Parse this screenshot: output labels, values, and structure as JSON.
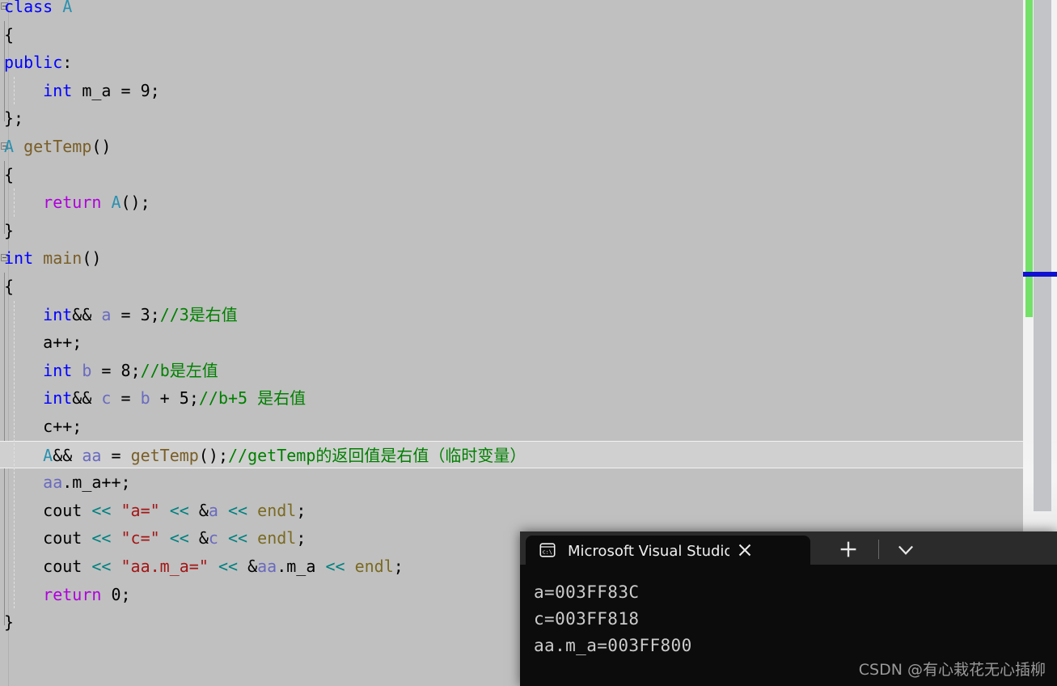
{
  "editor": {
    "background_color": "#c0c0c0",
    "current_line_index": 16,
    "lines": [
      {
        "indent": 0,
        "fold": "collapse",
        "tokens": [
          {
            "t": "class ",
            "c": "kw"
          },
          {
            "t": "A",
            "c": "typ"
          }
        ]
      },
      {
        "indent": 0,
        "fold": "bar",
        "tokens": [
          {
            "t": "{",
            "c": "pl"
          }
        ]
      },
      {
        "indent": 0,
        "fold": "bar",
        "tokens": [
          {
            "t": "public",
            "c": "kw"
          },
          {
            "t": ":",
            "c": "pl"
          }
        ]
      },
      {
        "indent": 0,
        "fold": "bar",
        "tokens": [
          {
            "t": "    ",
            "c": "pl"
          },
          {
            "t": "int",
            "c": "kw"
          },
          {
            "t": " m_a = ",
            "c": "pl"
          },
          {
            "t": "9",
            "c": "num"
          },
          {
            "t": ";",
            "c": "pl"
          }
        ]
      },
      {
        "indent": 0,
        "fold": "barend",
        "tokens": [
          {
            "t": "};",
            "c": "pl"
          }
        ]
      },
      {
        "indent": 0,
        "fold": "collapse",
        "tokens": [
          {
            "t": "A",
            "c": "typ"
          },
          {
            "t": " ",
            "c": "pl"
          },
          {
            "t": "getTemp",
            "c": "fn"
          },
          {
            "t": "()",
            "c": "pl"
          }
        ]
      },
      {
        "indent": 0,
        "fold": "bar",
        "tokens": [
          {
            "t": "{",
            "c": "pl"
          }
        ]
      },
      {
        "indent": 0,
        "fold": "bar",
        "tokens": [
          {
            "t": "    ",
            "c": "pl"
          },
          {
            "t": "return",
            "c": "ctl"
          },
          {
            "t": " ",
            "c": "pl"
          },
          {
            "t": "A",
            "c": "typ"
          },
          {
            "t": "();",
            "c": "pl"
          }
        ]
      },
      {
        "indent": 0,
        "fold": "barend",
        "tokens": [
          {
            "t": "}",
            "c": "pl"
          }
        ]
      },
      {
        "indent": 0,
        "fold": "collapse",
        "tokens": [
          {
            "t": "int",
            "c": "kw"
          },
          {
            "t": " ",
            "c": "pl"
          },
          {
            "t": "main",
            "c": "fn"
          },
          {
            "t": "()",
            "c": "pl"
          }
        ]
      },
      {
        "indent": 0,
        "fold": "bar",
        "tokens": [
          {
            "t": "{",
            "c": "pl"
          }
        ]
      },
      {
        "indent": 0,
        "fold": "bar",
        "tokens": [
          {
            "t": "    ",
            "c": "pl"
          },
          {
            "t": "int",
            "c": "kw"
          },
          {
            "t": "&& ",
            "c": "pl"
          },
          {
            "t": "a",
            "c": "var"
          },
          {
            "t": " = ",
            "c": "pl"
          },
          {
            "t": "3",
            "c": "num"
          },
          {
            "t": ";",
            "c": "pl"
          },
          {
            "t": "//3是右值",
            "c": "cmt"
          }
        ]
      },
      {
        "indent": 0,
        "fold": "bar",
        "tokens": [
          {
            "t": "    a++;",
            "c": "pl"
          }
        ]
      },
      {
        "indent": 0,
        "fold": "bar",
        "tokens": [
          {
            "t": "    ",
            "c": "pl"
          },
          {
            "t": "int",
            "c": "kw"
          },
          {
            "t": " ",
            "c": "pl"
          },
          {
            "t": "b",
            "c": "var"
          },
          {
            "t": " = ",
            "c": "pl"
          },
          {
            "t": "8",
            "c": "num"
          },
          {
            "t": ";",
            "c": "pl"
          },
          {
            "t": "//b是左值",
            "c": "cmt"
          }
        ]
      },
      {
        "indent": 0,
        "fold": "bar",
        "tokens": [
          {
            "t": "    ",
            "c": "pl"
          },
          {
            "t": "int",
            "c": "kw"
          },
          {
            "t": "&& ",
            "c": "pl"
          },
          {
            "t": "c",
            "c": "var"
          },
          {
            "t": " = ",
            "c": "pl"
          },
          {
            "t": "b",
            "c": "var"
          },
          {
            "t": " + ",
            "c": "pl"
          },
          {
            "t": "5",
            "c": "num"
          },
          {
            "t": ";",
            "c": "pl"
          },
          {
            "t": "//b+5 是右值",
            "c": "cmt"
          }
        ]
      },
      {
        "indent": 0,
        "fold": "bar",
        "tokens": [
          {
            "t": "    c++;",
            "c": "pl"
          }
        ]
      },
      {
        "indent": 0,
        "fold": "bar",
        "tokens": [
          {
            "t": "    ",
            "c": "pl"
          },
          {
            "t": "A",
            "c": "typ"
          },
          {
            "t": "&& ",
            "c": "pl"
          },
          {
            "t": "aa",
            "c": "var"
          },
          {
            "t": " = ",
            "c": "pl"
          },
          {
            "t": "getTemp",
            "c": "fn"
          },
          {
            "t": "();",
            "c": "pl"
          },
          {
            "t": "//getTemp的返回值是右值（临时变量）",
            "c": "cmt"
          }
        ]
      },
      {
        "indent": 0,
        "fold": "bar",
        "tokens": [
          {
            "t": "    ",
            "c": "pl"
          },
          {
            "t": "aa",
            "c": "var"
          },
          {
            "t": ".m_a++;",
            "c": "pl"
          }
        ]
      },
      {
        "indent": 0,
        "fold": "bar",
        "tokens": [
          {
            "t": "    cout ",
            "c": "pl"
          },
          {
            "t": "<<",
            "c": "op"
          },
          {
            "t": " ",
            "c": "pl"
          },
          {
            "t": "\"a=\"",
            "c": "str"
          },
          {
            "t": " ",
            "c": "pl"
          },
          {
            "t": "<<",
            "c": "op"
          },
          {
            "t": " &",
            "c": "pl"
          },
          {
            "t": "a",
            "c": "var"
          },
          {
            "t": " ",
            "c": "pl"
          },
          {
            "t": "<<",
            "c": "op"
          },
          {
            "t": " ",
            "c": "pl"
          },
          {
            "t": "endl",
            "c": "endl"
          },
          {
            "t": ";",
            "c": "pl"
          }
        ]
      },
      {
        "indent": 0,
        "fold": "bar",
        "tokens": [
          {
            "t": "    cout ",
            "c": "pl"
          },
          {
            "t": "<<",
            "c": "op"
          },
          {
            "t": " ",
            "c": "pl"
          },
          {
            "t": "\"c=\"",
            "c": "str"
          },
          {
            "t": " ",
            "c": "pl"
          },
          {
            "t": "<<",
            "c": "op"
          },
          {
            "t": " &",
            "c": "pl"
          },
          {
            "t": "c",
            "c": "var"
          },
          {
            "t": " ",
            "c": "pl"
          },
          {
            "t": "<<",
            "c": "op"
          },
          {
            "t": " ",
            "c": "pl"
          },
          {
            "t": "endl",
            "c": "endl"
          },
          {
            "t": ";",
            "c": "pl"
          }
        ]
      },
      {
        "indent": 0,
        "fold": "bar",
        "tokens": [
          {
            "t": "    cout ",
            "c": "pl"
          },
          {
            "t": "<<",
            "c": "op"
          },
          {
            "t": " ",
            "c": "pl"
          },
          {
            "t": "\"aa.m_a=\"",
            "c": "str"
          },
          {
            "t": " ",
            "c": "pl"
          },
          {
            "t": "<<",
            "c": "op"
          },
          {
            "t": " &",
            "c": "pl"
          },
          {
            "t": "aa",
            "c": "var"
          },
          {
            "t": ".m_a ",
            "c": "pl"
          },
          {
            "t": "<<",
            "c": "op"
          },
          {
            "t": " ",
            "c": "pl"
          },
          {
            "t": "endl",
            "c": "endl"
          },
          {
            "t": ";",
            "c": "pl"
          }
        ]
      },
      {
        "indent": 0,
        "fold": "bar",
        "tokens": [
          {
            "t": "    ",
            "c": "pl"
          },
          {
            "t": "return",
            "c": "ctl"
          },
          {
            "t": " ",
            "c": "pl"
          },
          {
            "t": "0",
            "c": "num"
          },
          {
            "t": ";",
            "c": "pl"
          }
        ]
      },
      {
        "indent": 0,
        "fold": "barend",
        "tokens": [
          {
            "t": "}",
            "c": "pl"
          }
        ]
      }
    ],
    "plain_text": [
      "class A",
      "{",
      "public:",
      "    int m_a = 9;",
      "};",
      "A getTemp()",
      "{",
      "    return A();",
      "}",
      "int main()",
      "{",
      "    int&& a = 3;//3是右值",
      "    a++;",
      "    int b = 8;//b是左值",
      "    int&& c = b + 5;//b+5 是右值",
      "    c++;",
      "    A&& aa = getTemp();//getTemp的返回值是右值（临时变量）",
      "    aa.m_a++;",
      "    cout << \"a=\" << &a << endl;",
      "    cout << \"c=\" << &c << endl;",
      "    cout << \"aa.m_a=\" << &aa.m_a << endl;",
      "    return 0;",
      "}"
    ]
  },
  "scrollbar": {
    "change_bar_color": "#73e168",
    "thumb_color": "#c2c4c8",
    "caret_marker_color": "#1010d0",
    "track_color": "#f2f2f2"
  },
  "console": {
    "tab": {
      "icon": "terminal-cmd-icon",
      "title": "Microsoft Visual Studio 调试控",
      "close_label": "✕"
    },
    "new_tab_label": "+",
    "menu_label": "⌄",
    "background_color": "#0c0c0c",
    "output": [
      "a=003FF83C",
      "c=003FF818",
      "aa.m_a=003FF800"
    ],
    "watermark": "CSDN @有心栽花无心插柳"
  }
}
